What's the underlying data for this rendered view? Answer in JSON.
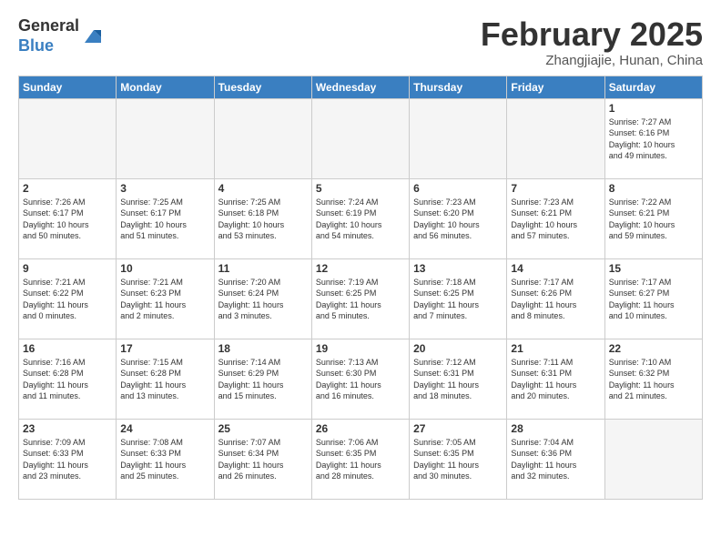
{
  "header": {
    "logo_general": "General",
    "logo_blue": "Blue",
    "month_title": "February 2025",
    "location": "Zhangjiajie, Hunan, China"
  },
  "weekdays": [
    "Sunday",
    "Monday",
    "Tuesday",
    "Wednesday",
    "Thursday",
    "Friday",
    "Saturday"
  ],
  "weeks": [
    [
      {
        "num": "",
        "info": "",
        "empty": true
      },
      {
        "num": "",
        "info": "",
        "empty": true
      },
      {
        "num": "",
        "info": "",
        "empty": true
      },
      {
        "num": "",
        "info": "",
        "empty": true
      },
      {
        "num": "",
        "info": "",
        "empty": true
      },
      {
        "num": "",
        "info": "",
        "empty": true
      },
      {
        "num": "1",
        "info": "Sunrise: 7:27 AM\nSunset: 6:16 PM\nDaylight: 10 hours\nand 49 minutes.",
        "empty": false
      }
    ],
    [
      {
        "num": "2",
        "info": "Sunrise: 7:26 AM\nSunset: 6:17 PM\nDaylight: 10 hours\nand 50 minutes.",
        "empty": false
      },
      {
        "num": "3",
        "info": "Sunrise: 7:25 AM\nSunset: 6:17 PM\nDaylight: 10 hours\nand 51 minutes.",
        "empty": false
      },
      {
        "num": "4",
        "info": "Sunrise: 7:25 AM\nSunset: 6:18 PM\nDaylight: 10 hours\nand 53 minutes.",
        "empty": false
      },
      {
        "num": "5",
        "info": "Sunrise: 7:24 AM\nSunset: 6:19 PM\nDaylight: 10 hours\nand 54 minutes.",
        "empty": false
      },
      {
        "num": "6",
        "info": "Sunrise: 7:23 AM\nSunset: 6:20 PM\nDaylight: 10 hours\nand 56 minutes.",
        "empty": false
      },
      {
        "num": "7",
        "info": "Sunrise: 7:23 AM\nSunset: 6:21 PM\nDaylight: 10 hours\nand 57 minutes.",
        "empty": false
      },
      {
        "num": "8",
        "info": "Sunrise: 7:22 AM\nSunset: 6:21 PM\nDaylight: 10 hours\nand 59 minutes.",
        "empty": false
      }
    ],
    [
      {
        "num": "9",
        "info": "Sunrise: 7:21 AM\nSunset: 6:22 PM\nDaylight: 11 hours\nand 0 minutes.",
        "empty": false
      },
      {
        "num": "10",
        "info": "Sunrise: 7:21 AM\nSunset: 6:23 PM\nDaylight: 11 hours\nand 2 minutes.",
        "empty": false
      },
      {
        "num": "11",
        "info": "Sunrise: 7:20 AM\nSunset: 6:24 PM\nDaylight: 11 hours\nand 3 minutes.",
        "empty": false
      },
      {
        "num": "12",
        "info": "Sunrise: 7:19 AM\nSunset: 6:25 PM\nDaylight: 11 hours\nand 5 minutes.",
        "empty": false
      },
      {
        "num": "13",
        "info": "Sunrise: 7:18 AM\nSunset: 6:25 PM\nDaylight: 11 hours\nand 7 minutes.",
        "empty": false
      },
      {
        "num": "14",
        "info": "Sunrise: 7:17 AM\nSunset: 6:26 PM\nDaylight: 11 hours\nand 8 minutes.",
        "empty": false
      },
      {
        "num": "15",
        "info": "Sunrise: 7:17 AM\nSunset: 6:27 PM\nDaylight: 11 hours\nand 10 minutes.",
        "empty": false
      }
    ],
    [
      {
        "num": "16",
        "info": "Sunrise: 7:16 AM\nSunset: 6:28 PM\nDaylight: 11 hours\nand 11 minutes.",
        "empty": false
      },
      {
        "num": "17",
        "info": "Sunrise: 7:15 AM\nSunset: 6:28 PM\nDaylight: 11 hours\nand 13 minutes.",
        "empty": false
      },
      {
        "num": "18",
        "info": "Sunrise: 7:14 AM\nSunset: 6:29 PM\nDaylight: 11 hours\nand 15 minutes.",
        "empty": false
      },
      {
        "num": "19",
        "info": "Sunrise: 7:13 AM\nSunset: 6:30 PM\nDaylight: 11 hours\nand 16 minutes.",
        "empty": false
      },
      {
        "num": "20",
        "info": "Sunrise: 7:12 AM\nSunset: 6:31 PM\nDaylight: 11 hours\nand 18 minutes.",
        "empty": false
      },
      {
        "num": "21",
        "info": "Sunrise: 7:11 AM\nSunset: 6:31 PM\nDaylight: 11 hours\nand 20 minutes.",
        "empty": false
      },
      {
        "num": "22",
        "info": "Sunrise: 7:10 AM\nSunset: 6:32 PM\nDaylight: 11 hours\nand 21 minutes.",
        "empty": false
      }
    ],
    [
      {
        "num": "23",
        "info": "Sunrise: 7:09 AM\nSunset: 6:33 PM\nDaylight: 11 hours\nand 23 minutes.",
        "empty": false
      },
      {
        "num": "24",
        "info": "Sunrise: 7:08 AM\nSunset: 6:33 PM\nDaylight: 11 hours\nand 25 minutes.",
        "empty": false
      },
      {
        "num": "25",
        "info": "Sunrise: 7:07 AM\nSunset: 6:34 PM\nDaylight: 11 hours\nand 26 minutes.",
        "empty": false
      },
      {
        "num": "26",
        "info": "Sunrise: 7:06 AM\nSunset: 6:35 PM\nDaylight: 11 hours\nand 28 minutes.",
        "empty": false
      },
      {
        "num": "27",
        "info": "Sunrise: 7:05 AM\nSunset: 6:35 PM\nDaylight: 11 hours\nand 30 minutes.",
        "empty": false
      },
      {
        "num": "28",
        "info": "Sunrise: 7:04 AM\nSunset: 6:36 PM\nDaylight: 11 hours\nand 32 minutes.",
        "empty": false
      },
      {
        "num": "",
        "info": "",
        "empty": true
      }
    ]
  ]
}
